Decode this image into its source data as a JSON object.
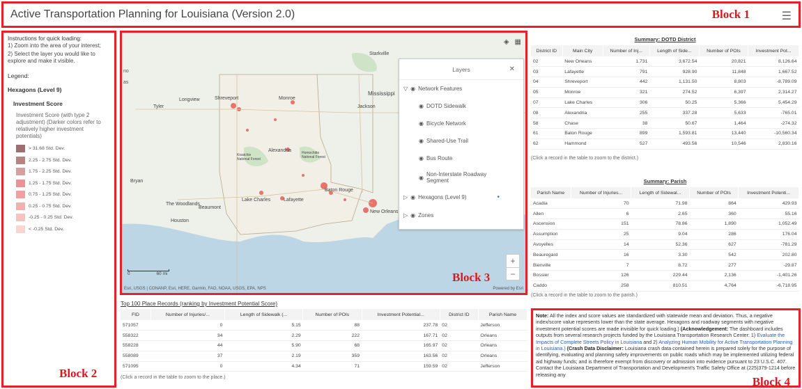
{
  "header": {
    "title": "Active Transportation Planning for Louisiana (Version 2.0)",
    "menu_icon": "hamburger-icon"
  },
  "block_labels": {
    "b1": "Block 1",
    "b2": "Block 2",
    "b3": "Block 3",
    "b4": "Block 4"
  },
  "left": {
    "instructions_title": "Instructions for quick loading:",
    "instr1": "1) Zoom into the area of your interest;",
    "instr2": "2) Select the layer you would like to explore and make it visible.",
    "legend_label": "Legend:",
    "hex_label": "Hexagons (Level 9)",
    "inv_label": "Investment Score",
    "inv_desc": "Investment Score (with type 2 adjustment) (Darker colors refer to relatively higher investment potentials)",
    "legend_items": [
      {
        "label": "> 31.68 Std. Dev.",
        "color": "#9c7070"
      },
      {
        "label": "2.25 - 2.75 Std. Dev.",
        "color": "#b88383"
      },
      {
        "label": "1.75 - 2.25 Std. Dev.",
        "color": "#d79f9f"
      },
      {
        "label": "1.25 - 1.75 Std. Dev.",
        "color": "#e89494"
      },
      {
        "label": "0.75 - 1.25 Std. Dev.",
        "color": "#f0a0a0"
      },
      {
        "label": "0.25 - 0.75 Std. Dev.",
        "color": "#f2b0ae"
      },
      {
        "label": "-0.25 - 0.25 Std. Dev.",
        "color": "#f6c4c0"
      },
      {
        "label": "< -0.25 Std. Dev.",
        "color": "#fad6d2"
      }
    ]
  },
  "map": {
    "states": [
      "Mississippi",
      "Lake Charles"
    ],
    "cities": {
      "starkville": "Starkville",
      "longview": "Longview",
      "shreveport": "Shreveport",
      "monroe": "Monroe",
      "jackson": "Jackson",
      "tyler": "Tyler",
      "alexandria": "Alexandria",
      "kisatchie": "Kisatchie National Forest",
      "homochitto": "Homochitto National Forest",
      "bryan": "Bryan",
      "woodlands": "The Woodlands",
      "beaumont": "Beaumont",
      "lakecharles": "Lake Charles",
      "lafayette": "Lafayette",
      "batonrouge": "Baton Rouge",
      "neworleans": "New Orleans",
      "houston": "Houston",
      "mississippi": "Mississippi",
      "zone1": "no",
      "zone2": "as"
    },
    "layers_title": "Layers",
    "layers": {
      "network": "Network Features",
      "sidewalk": "DOTD Sidewalk",
      "bicycle": "Bicycle Network",
      "trail": "Shared-Use Trail",
      "bus": "Bus Route",
      "roadway": "Non-Interstate Roadway Segment",
      "hexagons": "Hexagons (Level 9)",
      "zones": "Zones"
    },
    "scale": "60 mi",
    "scale_zero": "0",
    "attribution": "Esri, USGS | CONANP, Esri, HERE, Garmin, FAO, NOAA, USGS, EPA, NPS",
    "powered": "Powered by Esri"
  },
  "dotd": {
    "title": "Summary: DOTD District",
    "columns": [
      "District ID",
      "Main City",
      "Number of Inj...",
      "Length of Side...",
      "Number of POIs",
      "Investment Pot..."
    ],
    "rows": [
      [
        "02",
        "New Orleans",
        "1,731",
        "3,672.54",
        "20,821",
        "8,126.64"
      ],
      [
        "03",
        "Lafayette",
        "791",
        "928.90",
        "11,848",
        "1,667.52"
      ],
      [
        "04",
        "Shreveport",
        "442",
        "1,131.50",
        "8,803",
        "-8,789.09"
      ],
      [
        "05",
        "Monroe",
        "321",
        "274.52",
        "6,397",
        "2,314.27"
      ],
      [
        "07",
        "Lake Charles",
        "306",
        "50.25",
        "5,366",
        "5,454.29"
      ],
      [
        "08",
        "Alexandria",
        "255",
        "337.28",
        "5,633",
        "-765.01"
      ],
      [
        "58",
        "Chase",
        "38",
        "50.67",
        "1,464",
        "-274.32"
      ],
      [
        "61",
        "Baton Rouge",
        "899",
        "1,593.81",
        "13,440",
        "-10,560.34"
      ],
      [
        "62",
        "Hammond",
        "527",
        "493.56",
        "10,546",
        "2,830.16"
      ]
    ],
    "note": "(Click a record in the table to zoom to the district.)"
  },
  "parish": {
    "title": "Summary: Parish",
    "columns": [
      "Parish Name",
      "Number of Injuries...",
      "Length of Sidewal...",
      "Number of POIs",
      "Investment Potenti..."
    ],
    "rows": [
      [
        "Acadia",
        "70",
        "71.98",
        "864",
        "429.93"
      ],
      [
        "Allen",
        "6",
        "2.65",
        "360",
        "55.16"
      ],
      [
        "Ascension",
        "151",
        "78.86",
        "1,890",
        "1,052.49"
      ],
      [
        "Assumption",
        "25",
        "9.04",
        "286",
        "176.04"
      ],
      [
        "Avoyelles",
        "14",
        "52.36",
        "627",
        "-781.29"
      ],
      [
        "Beauregard",
        "16",
        "3.30",
        "542",
        "202.80"
      ],
      [
        "Bienville",
        "7",
        "8.72",
        "277",
        "-29.87"
      ],
      [
        "Bossier",
        "126",
        "229.44",
        "2,136",
        "-1,401.26"
      ],
      [
        "Caddo",
        "258",
        "810.51",
        "4,764",
        "-6,718.95"
      ]
    ],
    "note": "(Click a record in the table to zoom to the parish.)"
  },
  "places": {
    "title": "Top 100 Place Records (ranking by Investment Potential Score)",
    "columns": [
      "FID",
      "Number of Injuries/...",
      "Length of Sidewalk (...",
      "Number of POIs",
      "Investment Potential...",
      "District ID",
      "Parish Name"
    ],
    "rows": [
      [
        "571057",
        "0",
        "5.15",
        "88",
        "237.78",
        "02",
        "Jefferson"
      ],
      [
        "558322",
        "34",
        "2.29",
        "222",
        "167.71",
        "02",
        "Orleans"
      ],
      [
        "558228",
        "44",
        "5.90",
        "68",
        "165.97",
        "02",
        "Orleans"
      ],
      [
        "558089",
        "37",
        "2.19",
        "359",
        "163.56",
        "02",
        "Orleans"
      ],
      [
        "571095",
        "0",
        "4.34",
        "71",
        "159.59",
        "02",
        "Jefferson"
      ]
    ],
    "note": "(Click a record in the table to zoom to the place.)"
  },
  "block4": {
    "note_label": "Note:",
    "note_text": " All the index and score values are standardized with statewide mean and deviation. Thus, a negative index/score value represents lower than the state average. Hexagons and roadway segments with negative investment potential scores are made invisible for quick loading.)",
    "ack_label": "(Acknowledgement:",
    "ack_text": " The dashboard includes outputs from several research projects funded by the Louisiana Transportation Research Center: 1) ",
    "ack_link1": "Evaluate the Impacts of Complete Streets Policy in Louisiana",
    "ack_mid": " and 2) ",
    "ack_link2": "Analyzing Human Mobility for Active Transportation Planning in Louisiana.)",
    "crash_label": "(Crash Data Disclaimer:",
    "crash_text": " Louisiana crash data contained herein is prepared solely for the purpose of identifying, evaluating and planning safety improvements on public roads which may be implemented utilizing federal aid highway funds; and is therefore exempt from discovery or admission into evidence pursuant to 23 U.S.C. 407. Contact the Louisiana Department of Transportation and Development's Traffic Safety Office at (225)379-1214 before releasing any"
  }
}
